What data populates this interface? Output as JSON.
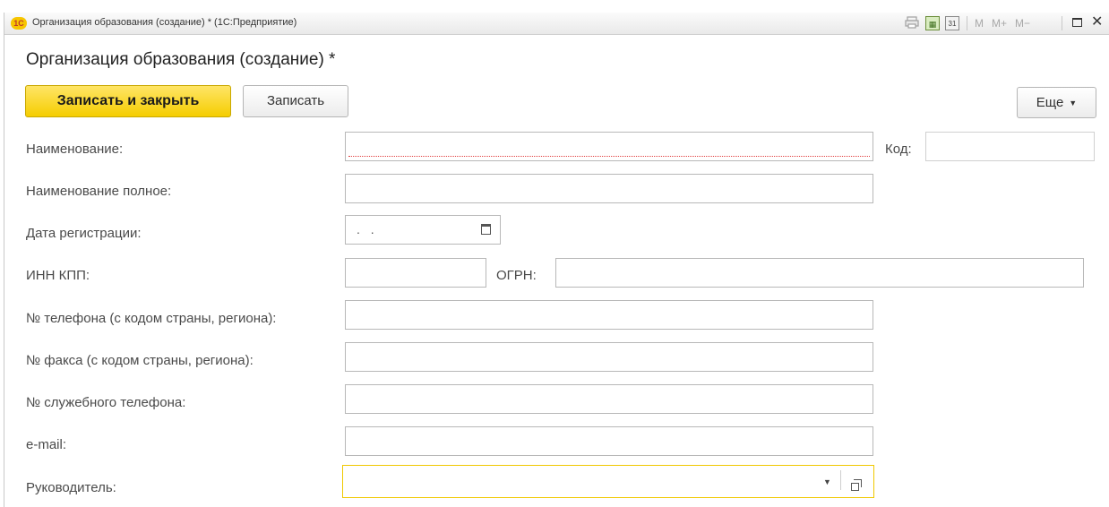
{
  "titlebar": {
    "logo_text": "1С",
    "title": "Организация образования (создание) * (1С:Предприятие)",
    "calc_label": "▦",
    "calendar_label": "31",
    "m_label": "M",
    "mplus_label": "M+",
    "mminus_label": "M−",
    "close_label": "✕"
  },
  "form": {
    "title": "Организация образования (создание) *"
  },
  "toolbar": {
    "save_close_label": "Записать и закрыть",
    "save_label": "Записать",
    "more_label": "Еще",
    "more_caret": "▼"
  },
  "fields": {
    "name": {
      "label": "Наименование:",
      "value": ""
    },
    "code": {
      "label": "Код:",
      "value": ""
    },
    "full_name": {
      "label": "Наименование полное:",
      "value": ""
    },
    "reg_date": {
      "label": "Дата регистрации:",
      "value": ". ."
    },
    "inn_kpp": {
      "label": "ИНН КПП:",
      "value": ""
    },
    "ogrn": {
      "label": "ОГРН:",
      "value": ""
    },
    "phone": {
      "label": "№ телефона (с кодом страны, региона):",
      "value": ""
    },
    "fax": {
      "label": "№ факса (с кодом страны, региона):",
      "value": ""
    },
    "office_phone": {
      "label": "№ служебного телефона:",
      "value": ""
    },
    "email": {
      "label": "e-mail:",
      "value": ""
    },
    "head": {
      "label": "Руководитель:",
      "value": "",
      "dropdown_caret": "▼"
    }
  },
  "colors": {
    "primary_button": "#f5cd00",
    "focus_border": "#f0c800",
    "invalid_underline": "#e04040"
  }
}
